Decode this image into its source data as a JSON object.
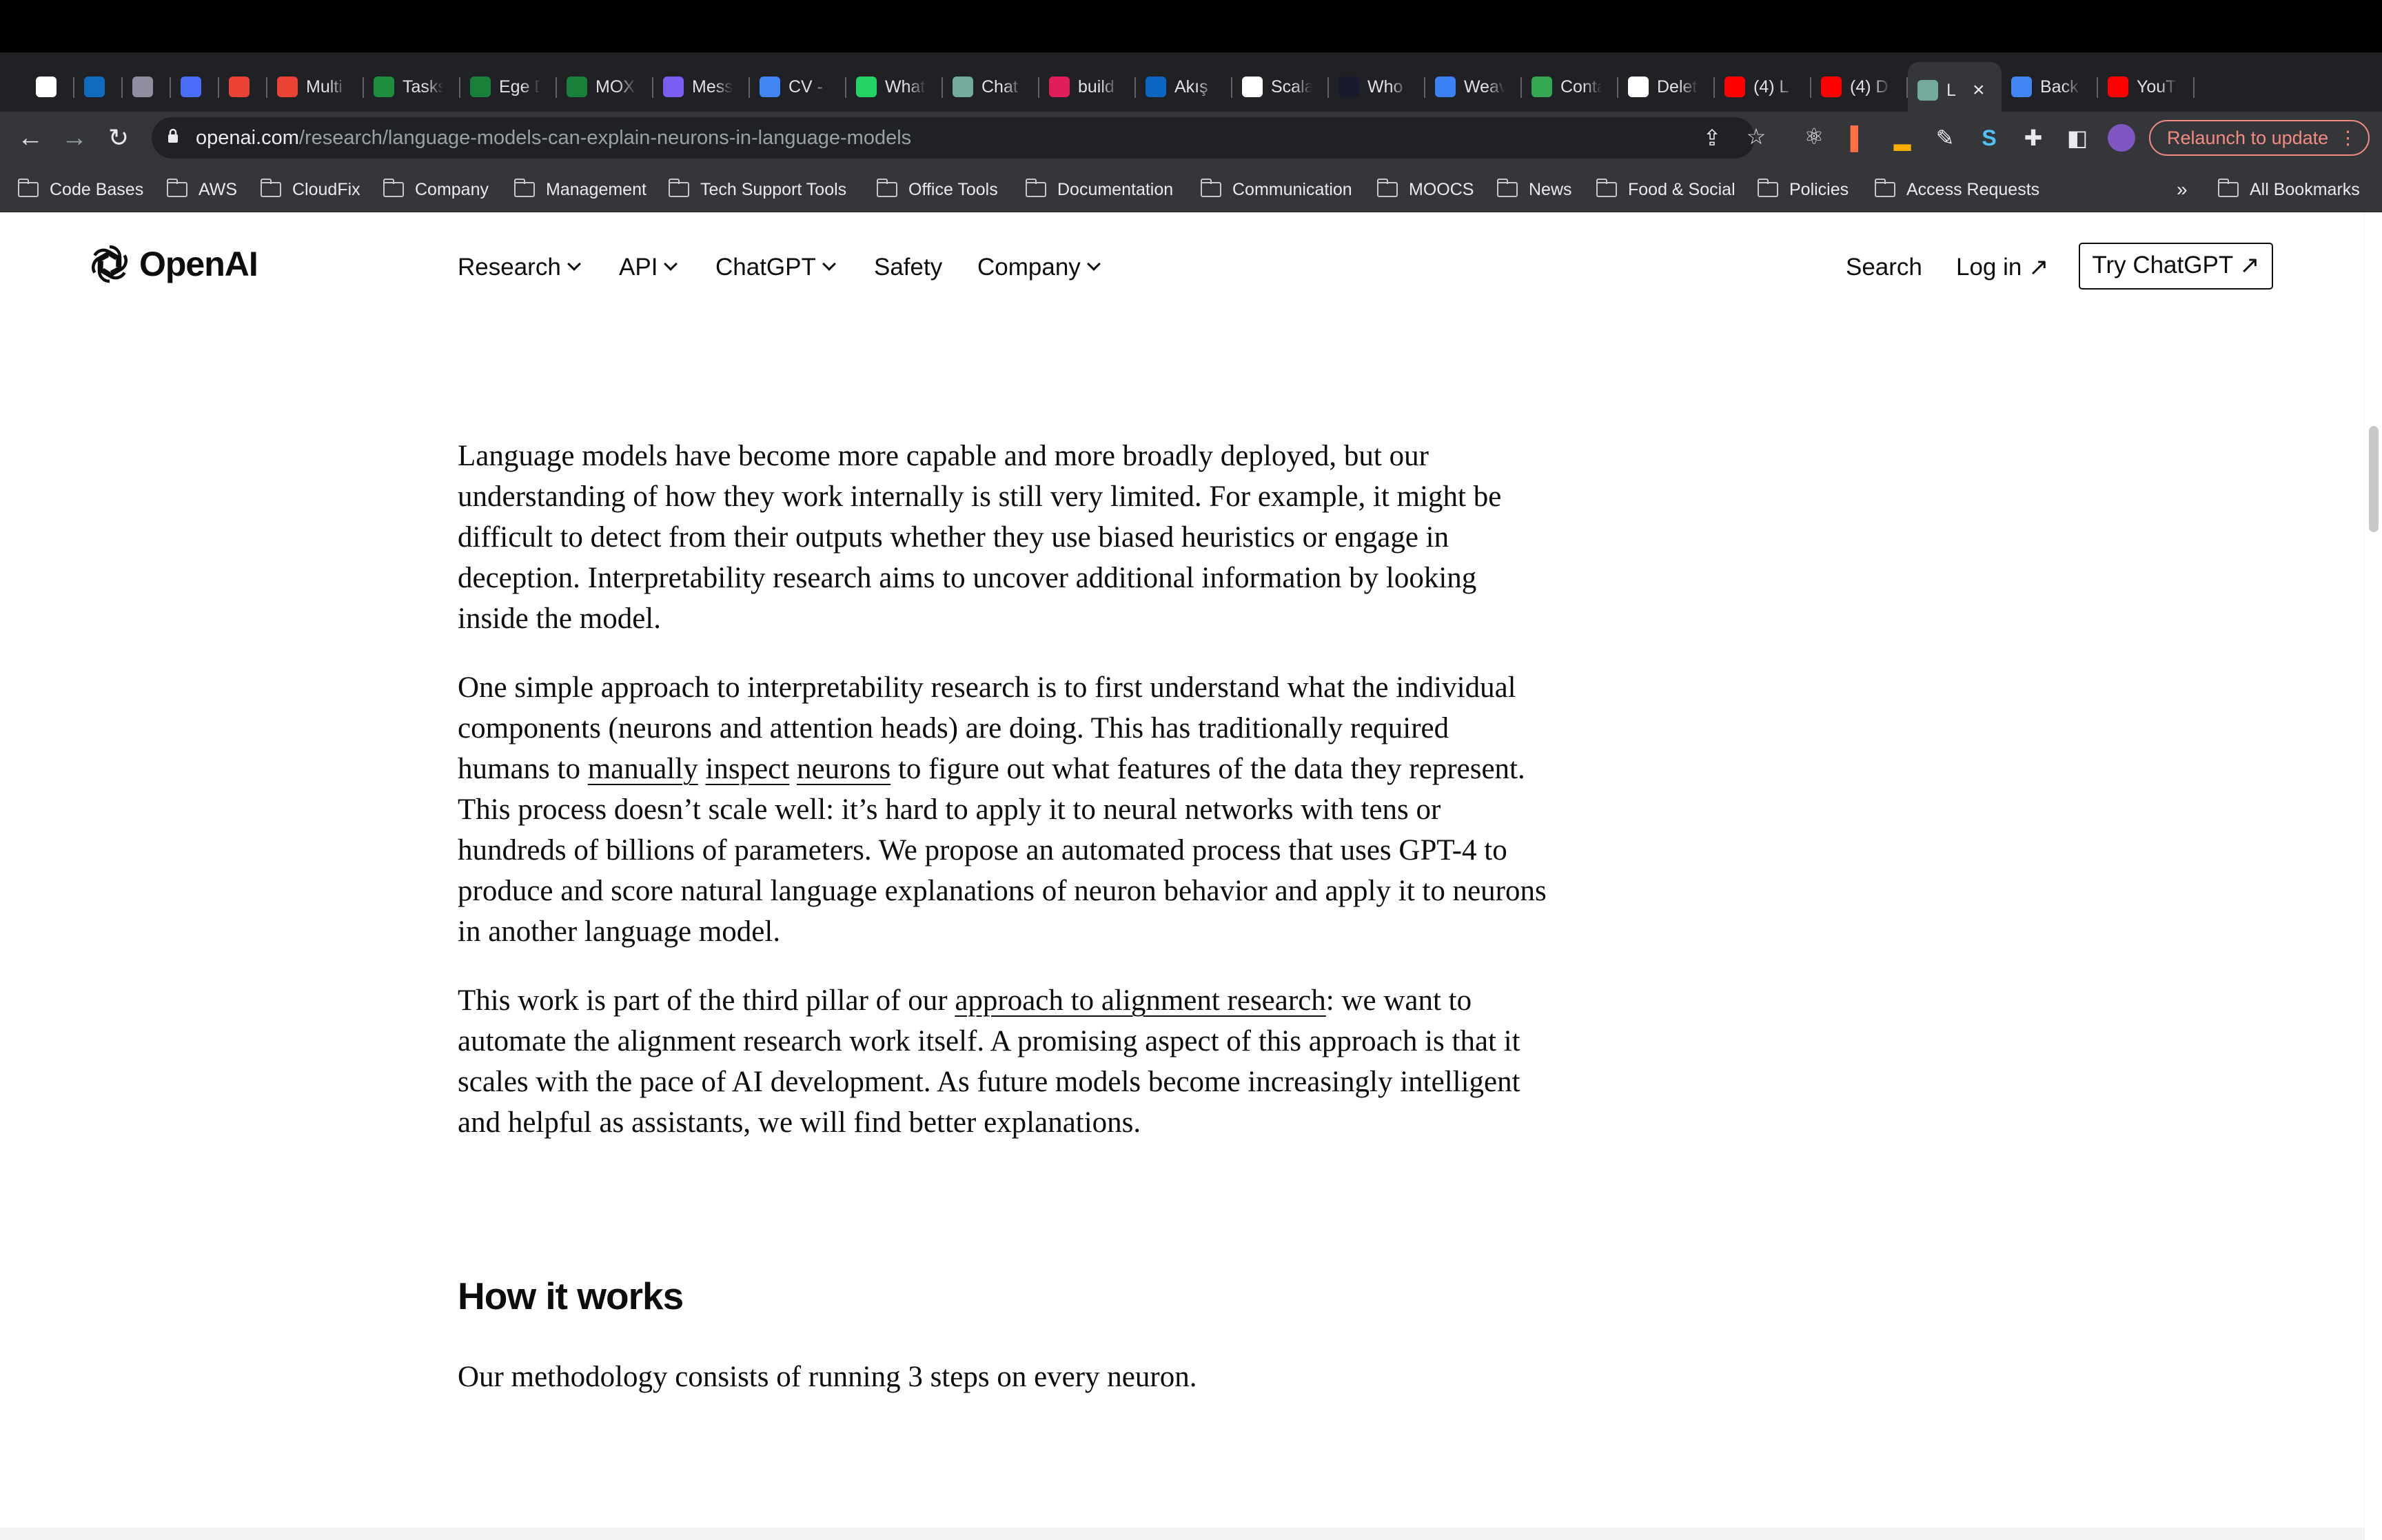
{
  "browser": {
    "tabs": [
      {
        "label": "",
        "icon": "apps-grid-icon",
        "color": "#ffffff"
      },
      {
        "label": "",
        "icon": "outlook-icon",
        "color": "#0f6cbd"
      },
      {
        "label": "",
        "icon": "claude-icon",
        "color": "#8e8ea0"
      },
      {
        "label": "",
        "icon": "clockify-icon",
        "color": "#4a6cf7"
      },
      {
        "label": "",
        "icon": "gmail-icon",
        "color": "#ea4335"
      },
      {
        "label": "Multi",
        "icon": "gmail-icon",
        "color": "#ea4335"
      },
      {
        "label": "Tasks",
        "icon": "tasks-icon",
        "color": "#1e8e3e"
      },
      {
        "label": "Ege D",
        "icon": "sheets-icon",
        "color": "#188038"
      },
      {
        "label": "MOX",
        "icon": "sheets-icon",
        "color": "#188038"
      },
      {
        "label": "Mess",
        "icon": "messenger-icon",
        "color": "#7b5cf5"
      },
      {
        "label": "CV -",
        "icon": "docs-icon",
        "color": "#4285f4"
      },
      {
        "label": "What",
        "icon": "whatsapp-icon",
        "color": "#25d366"
      },
      {
        "label": "Chat",
        "icon": "chatgpt-icon",
        "color": "#74aa9c"
      },
      {
        "label": "build",
        "icon": "slack-icon",
        "color": "#e01e5a"
      },
      {
        "label": "Akış",
        "icon": "linkedin-icon",
        "color": "#0a66c2"
      },
      {
        "label": "Scala",
        "icon": "medium-icon",
        "color": "#ffffff"
      },
      {
        "label": "Who",
        "icon": "vercel-icon",
        "color": "#1a1a2e"
      },
      {
        "label": "Weav",
        "icon": "weaviate-icon",
        "color": "#3b82f6"
      },
      {
        "label": "Conta",
        "icon": "green-dot-icon",
        "color": "#34a853"
      },
      {
        "label": "Delet",
        "icon": "github-icon",
        "color": "#ffffff"
      },
      {
        "label": "(4) L",
        "icon": "youtube-icon",
        "color": "#ff0000"
      },
      {
        "label": "(4) D",
        "icon": "youtube-icon",
        "color": "#ff0000"
      },
      {
        "label": "L",
        "icon": "chatgpt-icon",
        "color": "#74aa9c",
        "active": true
      },
      {
        "label": "Back",
        "icon": "docs-icon",
        "color": "#4285f4"
      },
      {
        "label": "YouTu",
        "icon": "youtube-icon",
        "color": "#ff0000"
      }
    ],
    "new_tab_symbol": "+",
    "tab_menu_symbol": "⌄",
    "url_host": "openai.com",
    "url_path": "/research/language-models-can-explain-neurons-in-language-models",
    "relaunch_label": "Relaunch to update",
    "bookmarks": [
      "Code Bases",
      "AWS",
      "CloudFix",
      "Company",
      "Management",
      "Tech Support Tools",
      "Office Tools",
      "Documentation",
      "Communication",
      "MOOCS",
      "News",
      "Food & Social",
      "Policies",
      "Access Requests"
    ],
    "bookmarks_overflow": "»",
    "all_bookmarks": "All Bookmarks"
  },
  "site": {
    "logo_text": "OpenAI",
    "nav": [
      {
        "label": "Research",
        "dropdown": true
      },
      {
        "label": "API",
        "dropdown": true
      },
      {
        "label": "ChatGPT",
        "dropdown": true
      },
      {
        "label": "Safety",
        "dropdown": false
      },
      {
        "label": "Company",
        "dropdown": true
      }
    ],
    "search_label": "Search",
    "login_label": "Log in ↗",
    "try_label": "Try ChatGPT ↗"
  },
  "article": {
    "p1": "Language models have become more capable and more broadly deployed, but our understanding of how they work internally is still very limited. For example, it might be difficult to detect from their outputs whether they use biased heuristics or engage in deception. Interpretability research aims to uncover additional information by looking inside the model.",
    "p2_before": "One simple approach to interpretability research is to first understand what the individual components (neurons and attention heads) are doing. This has traditionally required humans to ",
    "p2_link1": "manually",
    "p2_link2": "inspect",
    "p2_link3": "neurons",
    "p2_after": " to figure out what features of the data they represent. This process doesn’t scale well: it’s hard to apply it to neural networks with tens or hundreds of billions of parameters. We propose an automated process that uses GPT-4 to produce and score natural language explanations of neuron behavior and apply it to neurons in another language model.",
    "p3_before": "This work is part of the third pillar of our ",
    "p3_link": "approach to alignment research",
    "p3_after": ": we want to automate the alignment research work itself. A promising aspect of this approach is that it scales with the pace of AI development. As future models become increasingly intelligent and helpful as assistants, we will find better explanations.",
    "heading": "How it works",
    "method": "Our methodology consists of running 3 steps on every neuron."
  }
}
